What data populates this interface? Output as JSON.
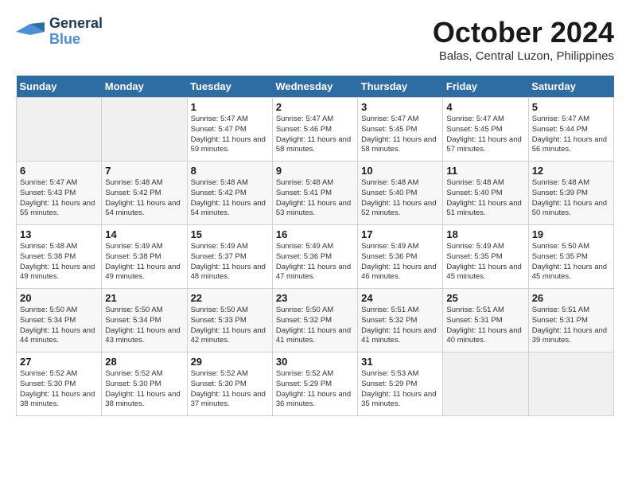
{
  "logo": {
    "line1": "General",
    "line2": "Blue"
  },
  "title": "October 2024",
  "location": "Balas, Central Luzon, Philippines",
  "days_of_week": [
    "Sunday",
    "Monday",
    "Tuesday",
    "Wednesday",
    "Thursday",
    "Friday",
    "Saturday"
  ],
  "weeks": [
    [
      {
        "day": "",
        "sunrise": "",
        "sunset": "",
        "daylight": ""
      },
      {
        "day": "",
        "sunrise": "",
        "sunset": "",
        "daylight": ""
      },
      {
        "day": "1",
        "sunrise": "Sunrise: 5:47 AM",
        "sunset": "Sunset: 5:47 PM",
        "daylight": "Daylight: 11 hours and 59 minutes."
      },
      {
        "day": "2",
        "sunrise": "Sunrise: 5:47 AM",
        "sunset": "Sunset: 5:46 PM",
        "daylight": "Daylight: 11 hours and 58 minutes."
      },
      {
        "day": "3",
        "sunrise": "Sunrise: 5:47 AM",
        "sunset": "Sunset: 5:45 PM",
        "daylight": "Daylight: 11 hours and 58 minutes."
      },
      {
        "day": "4",
        "sunrise": "Sunrise: 5:47 AM",
        "sunset": "Sunset: 5:45 PM",
        "daylight": "Daylight: 11 hours and 57 minutes."
      },
      {
        "day": "5",
        "sunrise": "Sunrise: 5:47 AM",
        "sunset": "Sunset: 5:44 PM",
        "daylight": "Daylight: 11 hours and 56 minutes."
      }
    ],
    [
      {
        "day": "6",
        "sunrise": "Sunrise: 5:47 AM",
        "sunset": "Sunset: 5:43 PM",
        "daylight": "Daylight: 11 hours and 55 minutes."
      },
      {
        "day": "7",
        "sunrise": "Sunrise: 5:48 AM",
        "sunset": "Sunset: 5:42 PM",
        "daylight": "Daylight: 11 hours and 54 minutes."
      },
      {
        "day": "8",
        "sunrise": "Sunrise: 5:48 AM",
        "sunset": "Sunset: 5:42 PM",
        "daylight": "Daylight: 11 hours and 54 minutes."
      },
      {
        "day": "9",
        "sunrise": "Sunrise: 5:48 AM",
        "sunset": "Sunset: 5:41 PM",
        "daylight": "Daylight: 11 hours and 53 minutes."
      },
      {
        "day": "10",
        "sunrise": "Sunrise: 5:48 AM",
        "sunset": "Sunset: 5:40 PM",
        "daylight": "Daylight: 11 hours and 52 minutes."
      },
      {
        "day": "11",
        "sunrise": "Sunrise: 5:48 AM",
        "sunset": "Sunset: 5:40 PM",
        "daylight": "Daylight: 11 hours and 51 minutes."
      },
      {
        "day": "12",
        "sunrise": "Sunrise: 5:48 AM",
        "sunset": "Sunset: 5:39 PM",
        "daylight": "Daylight: 11 hours and 50 minutes."
      }
    ],
    [
      {
        "day": "13",
        "sunrise": "Sunrise: 5:48 AM",
        "sunset": "Sunset: 5:38 PM",
        "daylight": "Daylight: 11 hours and 49 minutes."
      },
      {
        "day": "14",
        "sunrise": "Sunrise: 5:49 AM",
        "sunset": "Sunset: 5:38 PM",
        "daylight": "Daylight: 11 hours and 49 minutes."
      },
      {
        "day": "15",
        "sunrise": "Sunrise: 5:49 AM",
        "sunset": "Sunset: 5:37 PM",
        "daylight": "Daylight: 11 hours and 48 minutes."
      },
      {
        "day": "16",
        "sunrise": "Sunrise: 5:49 AM",
        "sunset": "Sunset: 5:36 PM",
        "daylight": "Daylight: 11 hours and 47 minutes."
      },
      {
        "day": "17",
        "sunrise": "Sunrise: 5:49 AM",
        "sunset": "Sunset: 5:36 PM",
        "daylight": "Daylight: 11 hours and 46 minutes."
      },
      {
        "day": "18",
        "sunrise": "Sunrise: 5:49 AM",
        "sunset": "Sunset: 5:35 PM",
        "daylight": "Daylight: 11 hours and 45 minutes."
      },
      {
        "day": "19",
        "sunrise": "Sunrise: 5:50 AM",
        "sunset": "Sunset: 5:35 PM",
        "daylight": "Daylight: 11 hours and 45 minutes."
      }
    ],
    [
      {
        "day": "20",
        "sunrise": "Sunrise: 5:50 AM",
        "sunset": "Sunset: 5:34 PM",
        "daylight": "Daylight: 11 hours and 44 minutes."
      },
      {
        "day": "21",
        "sunrise": "Sunrise: 5:50 AM",
        "sunset": "Sunset: 5:34 PM",
        "daylight": "Daylight: 11 hours and 43 minutes."
      },
      {
        "day": "22",
        "sunrise": "Sunrise: 5:50 AM",
        "sunset": "Sunset: 5:33 PM",
        "daylight": "Daylight: 11 hours and 42 minutes."
      },
      {
        "day": "23",
        "sunrise": "Sunrise: 5:50 AM",
        "sunset": "Sunset: 5:32 PM",
        "daylight": "Daylight: 11 hours and 41 minutes."
      },
      {
        "day": "24",
        "sunrise": "Sunrise: 5:51 AM",
        "sunset": "Sunset: 5:32 PM",
        "daylight": "Daylight: 11 hours and 41 minutes."
      },
      {
        "day": "25",
        "sunrise": "Sunrise: 5:51 AM",
        "sunset": "Sunset: 5:31 PM",
        "daylight": "Daylight: 11 hours and 40 minutes."
      },
      {
        "day": "26",
        "sunrise": "Sunrise: 5:51 AM",
        "sunset": "Sunset: 5:31 PM",
        "daylight": "Daylight: 11 hours and 39 minutes."
      }
    ],
    [
      {
        "day": "27",
        "sunrise": "Sunrise: 5:52 AM",
        "sunset": "Sunset: 5:30 PM",
        "daylight": "Daylight: 11 hours and 38 minutes."
      },
      {
        "day": "28",
        "sunrise": "Sunrise: 5:52 AM",
        "sunset": "Sunset: 5:30 PM",
        "daylight": "Daylight: 11 hours and 38 minutes."
      },
      {
        "day": "29",
        "sunrise": "Sunrise: 5:52 AM",
        "sunset": "Sunset: 5:30 PM",
        "daylight": "Daylight: 11 hours and 37 minutes."
      },
      {
        "day": "30",
        "sunrise": "Sunrise: 5:52 AM",
        "sunset": "Sunset: 5:29 PM",
        "daylight": "Daylight: 11 hours and 36 minutes."
      },
      {
        "day": "31",
        "sunrise": "Sunrise: 5:53 AM",
        "sunset": "Sunset: 5:29 PM",
        "daylight": "Daylight: 11 hours and 35 minutes."
      },
      {
        "day": "",
        "sunrise": "",
        "sunset": "",
        "daylight": ""
      },
      {
        "day": "",
        "sunrise": "",
        "sunset": "",
        "daylight": ""
      }
    ]
  ]
}
